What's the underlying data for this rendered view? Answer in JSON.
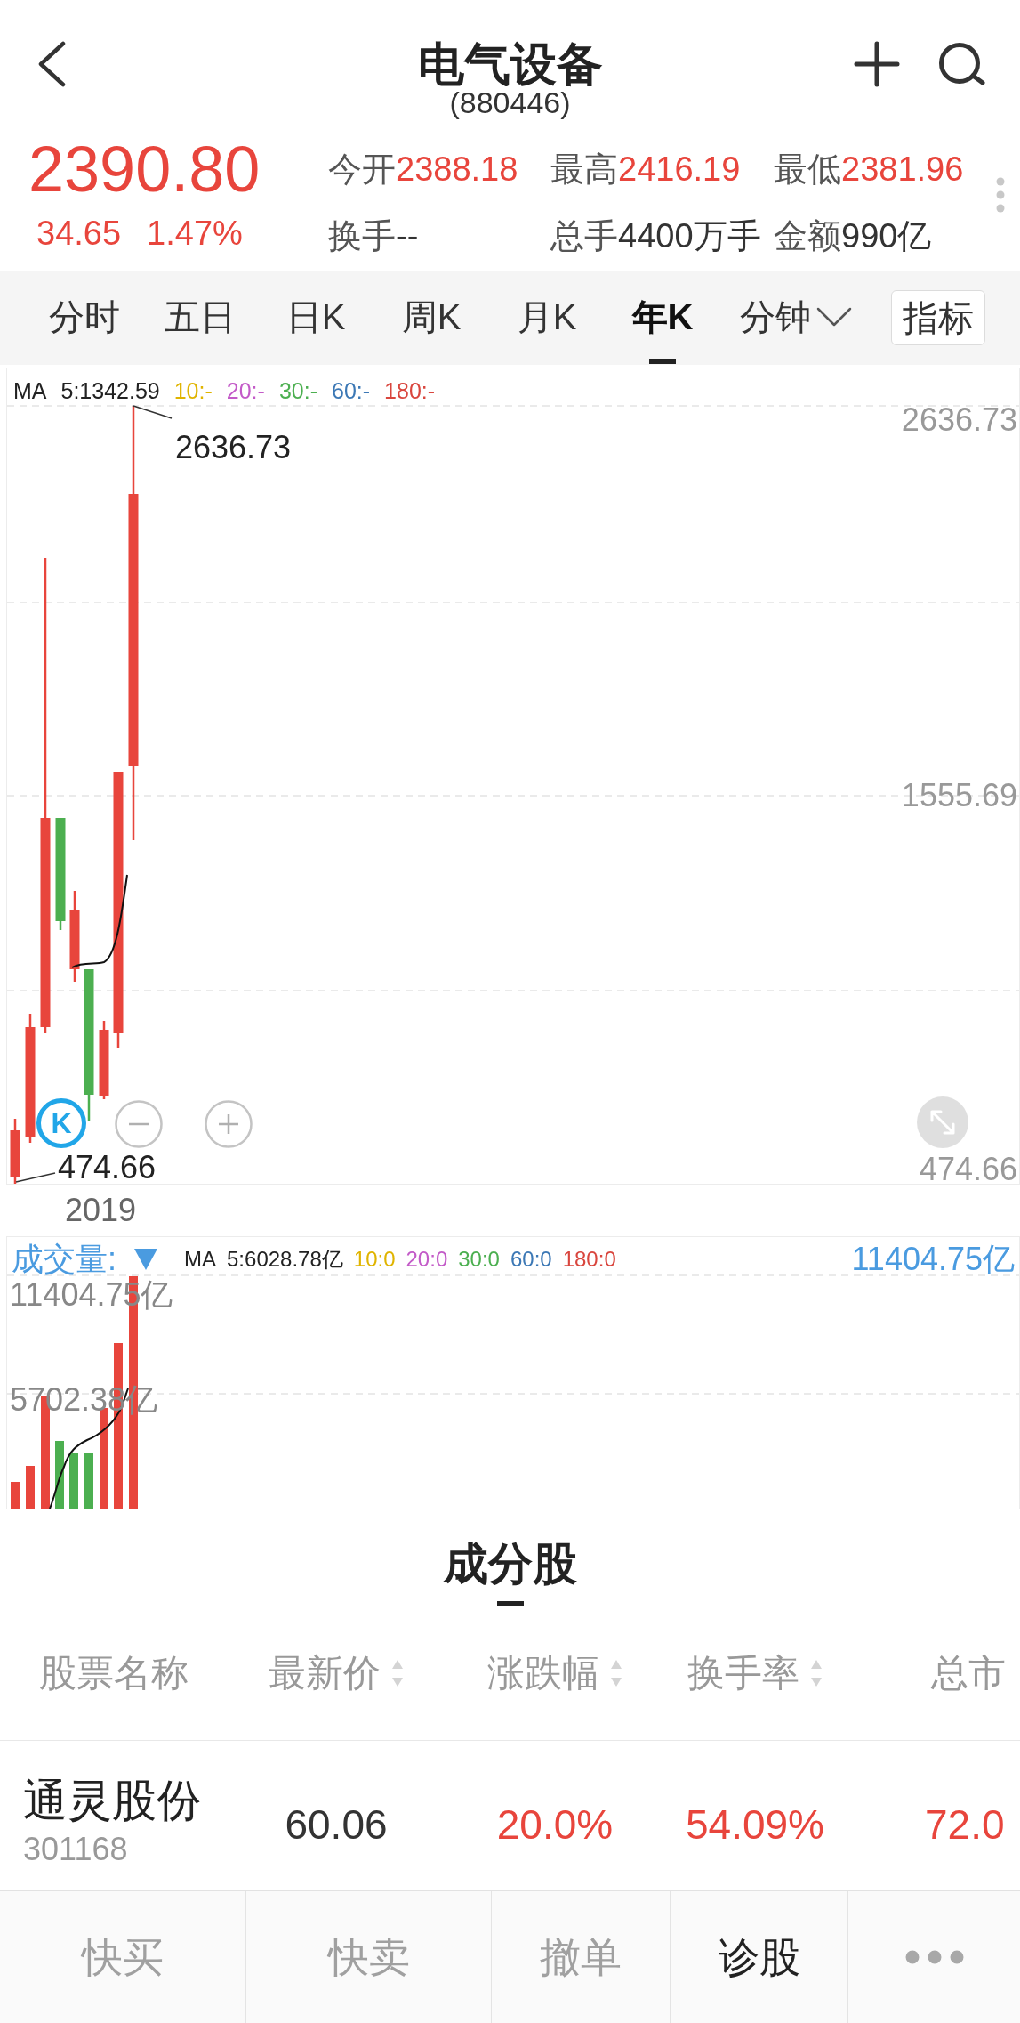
{
  "header": {
    "title": "电气设备",
    "code": "(880446)"
  },
  "quote": {
    "up": true,
    "price": "2390.80",
    "change": "34.65",
    "change_percent": "1.47%",
    "stat_rows": [
      {
        "stats": [
          {
            "label": "今开",
            "value": "2388.18",
            "up": true
          },
          {
            "label": "最高",
            "value": "2416.19",
            "up": true
          },
          {
            "label": "最低",
            "value": "2381.96",
            "up": true
          }
        ]
      },
      {
        "stats": [
          {
            "label": "换手",
            "value": "--",
            "up": false
          },
          {
            "label": "总手",
            "value": "4400万手",
            "up": false
          },
          {
            "label": "金额",
            "value": "990亿",
            "up": false
          }
        ]
      }
    ]
  },
  "period_tabs": {
    "tabs": [
      {
        "label": "分时",
        "kind": "tab",
        "selected": false
      },
      {
        "label": "五日",
        "kind": "tab",
        "selected": false
      },
      {
        "label": "日K",
        "kind": "tab",
        "selected": false
      },
      {
        "label": "周K",
        "kind": "tab",
        "selected": false
      },
      {
        "label": "月K",
        "kind": "tab",
        "selected": false
      },
      {
        "label": "年K",
        "kind": "tab",
        "selected": true
      },
      {
        "label": "分钟",
        "kind": "dropdown",
        "selected": false
      }
    ],
    "indicator_button": "指标"
  },
  "kline_chart": {
    "legend": {
      "label": "MA",
      "items": [
        {
          "text": "5:1342.59",
          "color": "#222222"
        },
        {
          "text": "10:-",
          "color": "#e0b400"
        },
        {
          "text": "20:-",
          "color": "#c35bc8"
        },
        {
          "text": "30:-",
          "color": "#4caf50"
        },
        {
          "text": "60:-",
          "color": "#3c78b5"
        },
        {
          "text": "180:-",
          "color": "#d9463e"
        }
      ]
    },
    "high_label": "2636.73",
    "low_label": "474.66",
    "y_labels": [
      "2636.73",
      "1555.69",
      "474.66"
    ],
    "k_button": "K",
    "x_labels": [
      "2019"
    ]
  },
  "volume_chart": {
    "title": "成交量:",
    "legend": {
      "label": "MA",
      "items": [
        {
          "text": "5:6028.78亿",
          "color": "#222222"
        },
        {
          "text": "10:0",
          "color": "#e0b400"
        },
        {
          "text": "20:0",
          "color": "#c35bc8"
        },
        {
          "text": "30:0",
          "color": "#4caf50"
        },
        {
          "text": "60:0",
          "color": "#3c78b5"
        },
        {
          "text": "180:0",
          "color": "#d9463e"
        }
      ]
    },
    "current_value": "11404.75亿",
    "y_labels": [
      "11404.75亿",
      "5702.38亿"
    ]
  },
  "constituents": {
    "title": "成分股",
    "columns": [
      {
        "label": "股票名称",
        "sortable": false
      },
      {
        "label": "最新价",
        "sortable": true
      },
      {
        "label": "涨跌幅",
        "sortable": true
      },
      {
        "label": "换手率",
        "sortable": true
      },
      {
        "label": "总市",
        "sortable": false
      }
    ],
    "rows": [
      {
        "cells": [
          {
            "kind": "stock",
            "name": "通灵股份",
            "code": "301168"
          },
          {
            "kind": "value",
            "text": "60.06",
            "up": false
          },
          {
            "kind": "value",
            "text": "20.0%",
            "up": true
          },
          {
            "kind": "value",
            "text": "54.09%",
            "up": true
          },
          {
            "kind": "value",
            "text": "72.0",
            "up": true
          }
        ]
      }
    ]
  },
  "toolbar": [
    {
      "label": "快买",
      "disabled": true
    },
    {
      "label": "快卖",
      "disabled": true
    },
    {
      "label": "撤单",
      "disabled": true
    },
    {
      "label": "诊股",
      "disabled": false
    }
  ]
}
